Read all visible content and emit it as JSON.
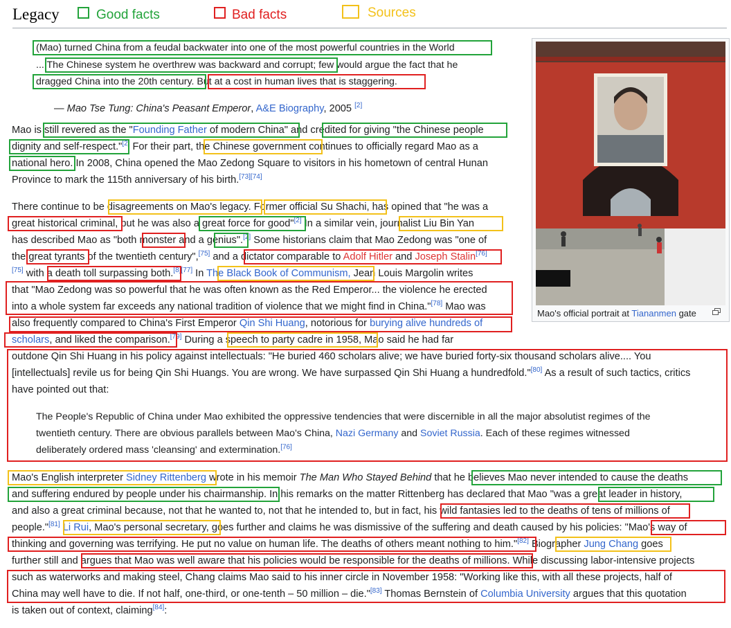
{
  "header": {
    "title": "Legacy",
    "legend": {
      "good": "Good facts",
      "bad": "Bad facts",
      "sources": "Sources"
    }
  },
  "colors": {
    "good": "#22a33a",
    "bad": "#e02020",
    "sources": "#f3c11a",
    "link": "#3366cc",
    "redlink": "#dd3333"
  },
  "quote1": {
    "l1": "(Mao) turned China from a feudal backwater into one of the most powerful countries in the World",
    "l2a": "... The Chinese system he overthrew was backward and corrupt;",
    "l2b": " few would argue the fact that he",
    "l3a": "dragged China into the 20th century.",
    "l3b": " But at a cost in human lives that is staggering.",
    "attr_dash": "— ",
    "attr_title": "Mao Tse Tung: China's Peasant Emperor",
    "attr_sep": ", ",
    "attr_link": "A&E Biography",
    "attr_year": ", 2005 ",
    "attr_ref": "[2]"
  },
  "para1": {
    "l1a": "Mao is ",
    "l1b": "still revered as the \"",
    "l1c": "Founding Father",
    "l1d": " of modern China\"",
    "l1e": " and ",
    "l1f": "credited for giving \"the Chinese people",
    "l2a": "dignity and self-respect.\"",
    "l2r": "[2]",
    "l2b": " For their part, ",
    "l2c": "the Chinese government",
    "l2d": " continues to officially regard Mao as a",
    "l3a": "national hero.",
    "l3b": " In 2008, China opened the Mao Zedong Square to visitors in his hometown of central Hunan",
    "l4a": "Province to mark the 115th anniversary of his birth.",
    "l4r": "[73][74]"
  },
  "para2": {
    "l1a": "There continue to be ",
    "l1b": "disagreements on Mao's legacy.",
    "l1c": " ",
    "l1d": "Former official Su Shachi,",
    "l1e": " has opined that \"he was a",
    "l2a": "great historical criminal,",
    "l2b": " but he was also ",
    "l2c": "a great force for good",
    "l2d": "\"",
    "l2r": "[2]",
    "l2e": " In a similar vein, ",
    "l2f": "journalist Liu Bin Yan",
    "l3a": "has described Mao as \"both ",
    "l3b": "monster",
    "l3c": " and a ",
    "l3d": "genius",
    "l3e": "\".",
    "l3r": "[2]",
    "l3f": " Some historians claim that Mao Zedong was \"one of",
    "l4a": "the ",
    "l4b": "great tyrants",
    "l4c": " of the twentieth century\",",
    "l4r": "[75]",
    "l4d": " and ",
    "l4e": "a dictator comparable to ",
    "l4f": "Adolf Hitler",
    "l4g": " and ",
    "l4h": "Joseph Stalin",
    "l4r2": "[76]",
    "l5r": "[75]",
    "l5a": " with ",
    "l5b": "a death toll surpassing both.",
    "l5r2": "[8][77]",
    "l5c": " In ",
    "l5d": "The Black Book of Communism,",
    "l5e": " Jean Louis Margolin writes",
    "l6": "that \"Mao Zedong was so powerful that he was often known as the Red Emperor... the violence he erected",
    "l7a": "into a whole system far exceeds any national tradition of violence that we might find in China.\"",
    "l7r": "[78]",
    "l7b": " Mao was",
    "l8a": "also frequently compared to China's First Emperor ",
    "l8b": "Qin Shi Huang",
    "l8c": ", notorious for ",
    "l8d": "burying alive hundreds of",
    "l9a": "scholars",
    "l9b": ", and liked the comparison.",
    "l9r": "[79]",
    "l9c": " During ",
    "l9d": "a speech to party cadre in 1958",
    "l9e": ", Mao said he had far",
    "l10": "outdone Qin Shi Huang in his policy against intellectuals: \"He buried 460 scholars alive; we have buried forty-six thousand scholars alive.... You",
    "l11a": "[intellectuals] revile us for being Qin Shi Huangs. You are wrong. We have surpassed Qin Shi Huang a hundredfold.\"",
    "l11r": "[80]",
    "l11b": " As a result of such tactics, critics",
    "l12": "have pointed out that:"
  },
  "quote2": {
    "l1": "The People's Republic of China under Mao exhibited the oppressive tendencies that were discernible in all the major absolutist regimes of the",
    "l2a": "twentieth century. There are obvious parallels between Mao's China, ",
    "l2b": "Nazi Germany",
    "l2c": " and ",
    "l2d": "Soviet Russia",
    "l2e": ". Each of these regimes witnessed",
    "l3a": "deliberately ordered mass 'cleansing' and extermination.",
    "l3r": "[76]"
  },
  "para3": {
    "l1a": "Mao's English interpreter ",
    "l1b": "Sidney Rittenberg",
    "l1c": " wrote in his memoir ",
    "l1d": "The Man Who Stayed Behind",
    "l1e": " that ",
    "l1f": "he believes Mao never intended to cause the deaths",
    "l2a": "and suffering endured by people under his chairmanship.",
    "l2b": " In his remarks on the matter Rittenberg has declared that Mao \"was ",
    "l2c": "a great leader in history,",
    "l3a": "and also a great criminal because, not that he wanted to, not that he intended to, but in fact, ",
    "l3b": "his wild fantasies led to the deaths of tens of millions",
    "l3c": " of",
    "l4a": "people.\"",
    "l4r": "[81]",
    "l4b": " ",
    "l4c": "Li Rui",
    "l4d": ", Mao's personal secretary,",
    "l4e": " goes further and claims he was dismissive of the suffering and death caused by his policies: ",
    "l4f": "\"Mao's way of",
    "l5a": "thinking and governing was terrifying. He put no value on human life. The deaths of others meant nothing to him.\"",
    "l5r": "[82]",
    "l5b": " ",
    "l5c": "Biographer ",
    "l5d": "Jung Chang",
    "l5e": " goes",
    "l6a": "further still and ",
    "l6b": "argues that Mao was well aware that his policies would be responsible for the deaths of millions.",
    "l6c": " While discussing labor-intensive projects",
    "l7": "such as waterworks and making steel, Chang claims Mao said to his inner circle in November 1958: \"Working like this, with all these projects, half of",
    "l8a": "China may well have to die. If not half, one-third, or one-tenth – 50 million – die.\"",
    "l8r": "[83]",
    "l8b": " Thomas Bernstein of ",
    "l8c": "Columbia University",
    "l8d": " argues that this quotation",
    "l9a": "is taken out of context, claiming",
    "l9r": "[84]",
    "l9b": ":"
  },
  "image": {
    "caption_a": "Mao's official portrait at ",
    "caption_link": "Tiananmen",
    "caption_b": " gate",
    "icon": "magnify-icon"
  }
}
